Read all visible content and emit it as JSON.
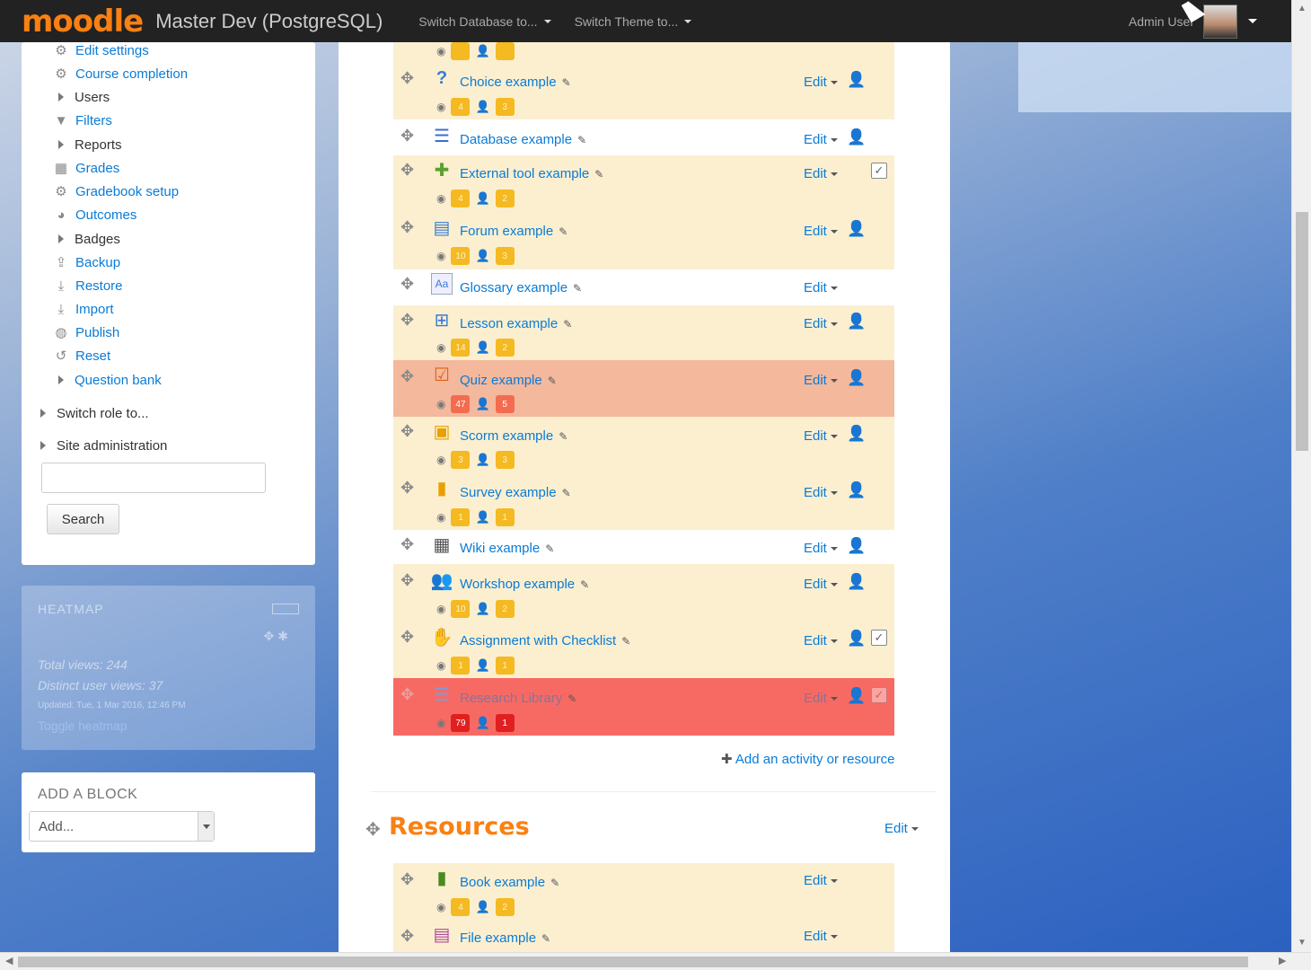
{
  "navbar": {
    "logo": "moodle",
    "site_name": "Master Dev (PostgreSQL)",
    "menu1": "Switch Database to...",
    "menu2": "Switch Theme to...",
    "user_name": "Admin User"
  },
  "nav": {
    "items": [
      {
        "label": "Edit settings",
        "icon": "gear-icon"
      },
      {
        "label": "Course completion",
        "icon": "gear-icon"
      },
      {
        "label": "Users",
        "icon": "caret-right-icon"
      },
      {
        "label": "Filters",
        "icon": "filter-icon"
      },
      {
        "label": "Reports",
        "icon": "caret-right-icon"
      },
      {
        "label": "Grades",
        "icon": "table-icon"
      },
      {
        "label": "Gradebook setup",
        "icon": "gear-icon"
      },
      {
        "label": "Outcomes",
        "icon": "pie-icon"
      },
      {
        "label": "Badges",
        "icon": "caret-right-icon"
      },
      {
        "label": "Backup",
        "icon": "upload-icon"
      },
      {
        "label": "Restore",
        "icon": "download-icon"
      },
      {
        "label": "Import",
        "icon": "download-icon"
      },
      {
        "label": "Publish",
        "icon": "globe-icon"
      },
      {
        "label": "Reset",
        "icon": "reset-icon"
      },
      {
        "label": "Question bank",
        "icon": "caret-right-icon"
      }
    ],
    "switch_role": "Switch role to...",
    "site_admin": "Site administration",
    "search_button": "Search"
  },
  "heatmap": {
    "title": "HEATMAP",
    "total_views": "Total views: 244",
    "distinct_users": "Distinct user views: 37",
    "updated": "Updated: Tue, 1 Mar 2016, 12:46 PM",
    "toggle": "Toggle heatmap"
  },
  "add_block": {
    "title": "ADD A BLOCK",
    "select_value": "Add..."
  },
  "activities": [
    {
      "name": "Choice example",
      "icon": "choice-icon",
      "edit": "Edit",
      "views": "4",
      "users": "3"
    },
    {
      "name": "Database example",
      "icon": "database-icon",
      "edit": "Edit"
    },
    {
      "name": "External tool example",
      "icon": "puzzle-icon",
      "edit": "Edit",
      "views": "4",
      "users": "2"
    },
    {
      "name": "Forum example",
      "icon": "forum-icon",
      "edit": "Edit",
      "views": "10",
      "users": "3"
    },
    {
      "name": "Glossary example",
      "icon": "glossary-icon",
      "edit": "Edit"
    },
    {
      "name": "Lesson example",
      "icon": "lesson-icon",
      "edit": "Edit",
      "views": "14",
      "users": "2"
    },
    {
      "name": "Quiz example",
      "icon": "quiz-icon",
      "edit": "Edit",
      "views": "47",
      "users": "5"
    },
    {
      "name": "Scorm example",
      "icon": "scorm-icon",
      "edit": "Edit",
      "views": "3",
      "users": "3"
    },
    {
      "name": "Survey example",
      "icon": "survey-icon",
      "edit": "Edit",
      "views": "1",
      "users": "1"
    },
    {
      "name": "Wiki example",
      "icon": "wiki-icon",
      "edit": "Edit"
    },
    {
      "name": "Workshop example",
      "icon": "workshop-icon",
      "edit": "Edit",
      "views": "10",
      "users": "2"
    },
    {
      "name": "Assignment with Checklist",
      "icon": "assignment-icon",
      "edit": "Edit",
      "views": "1",
      "users": "1"
    },
    {
      "name": "Research Library",
      "icon": "database-icon",
      "edit": "Edit",
      "views": "79",
      "users": "1"
    }
  ],
  "add_activity": "Add an activity or resource",
  "resources": {
    "title": "Resources",
    "edit": "Edit",
    "items": [
      {
        "name": "Book example",
        "icon": "book-icon",
        "edit": "Edit",
        "views": "4",
        "users": "2"
      },
      {
        "name": "File example",
        "icon": "file-icon",
        "edit": "Edit"
      }
    ]
  },
  "colors": {
    "brand": "#f98012",
    "link": "#0a7bd6",
    "heat_low": "#fbefd0",
    "heat_mid": "#f4b89d",
    "heat_high": "#f76a63"
  }
}
